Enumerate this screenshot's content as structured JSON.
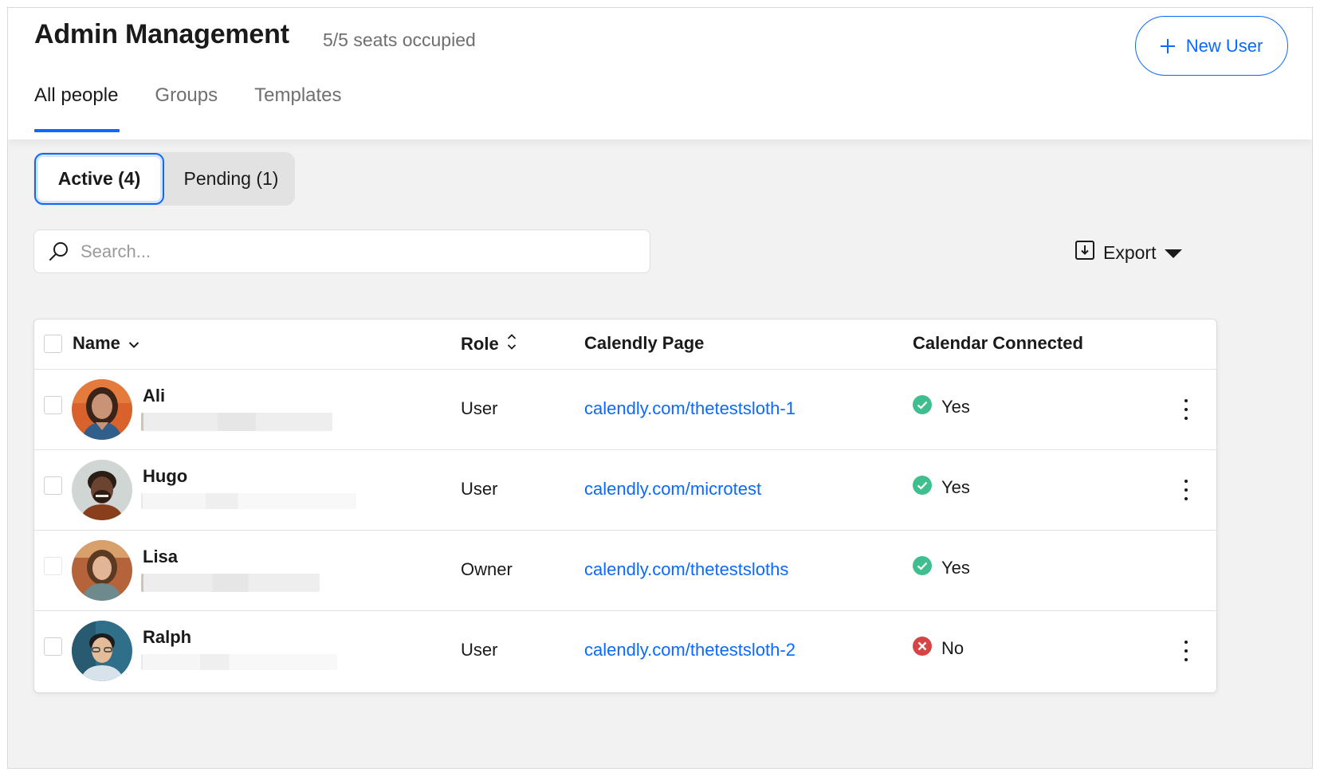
{
  "header": {
    "title": "Admin Management",
    "seats": "5/5 seats occupied",
    "new_user_label": "New User"
  },
  "tabs": [
    {
      "label": "All people",
      "active": true
    },
    {
      "label": "Groups",
      "active": false
    },
    {
      "label": "Templates",
      "active": false
    }
  ],
  "filter": {
    "active_label": "Active (4)",
    "pending_label": "Pending (1)"
  },
  "search": {
    "placeholder": "Search..."
  },
  "export": {
    "label": "Export"
  },
  "table": {
    "columns": {
      "name": "Name",
      "role": "Role",
      "page": "Calendly Page",
      "calendar": "Calendar Connected"
    },
    "rows": [
      {
        "name": "Ali",
        "role": "User",
        "page": "calendly.com/thetestsloth-1",
        "calendar": "Yes",
        "connected": true
      },
      {
        "name": "Hugo",
        "role": "User",
        "page": "calendly.com/microtest",
        "calendar": "Yes",
        "connected": true
      },
      {
        "name": "Lisa",
        "role": "Owner",
        "page": "calendly.com/thetestsloths",
        "calendar": "Yes",
        "connected": true
      },
      {
        "name": "Ralph",
        "role": "User",
        "page": "calendly.com/thetestsloth-2",
        "calendar": "No",
        "connected": false
      }
    ]
  },
  "colors": {
    "accent": "#0a69ff",
    "success": "#3fbf8f",
    "error": "#d64545"
  }
}
